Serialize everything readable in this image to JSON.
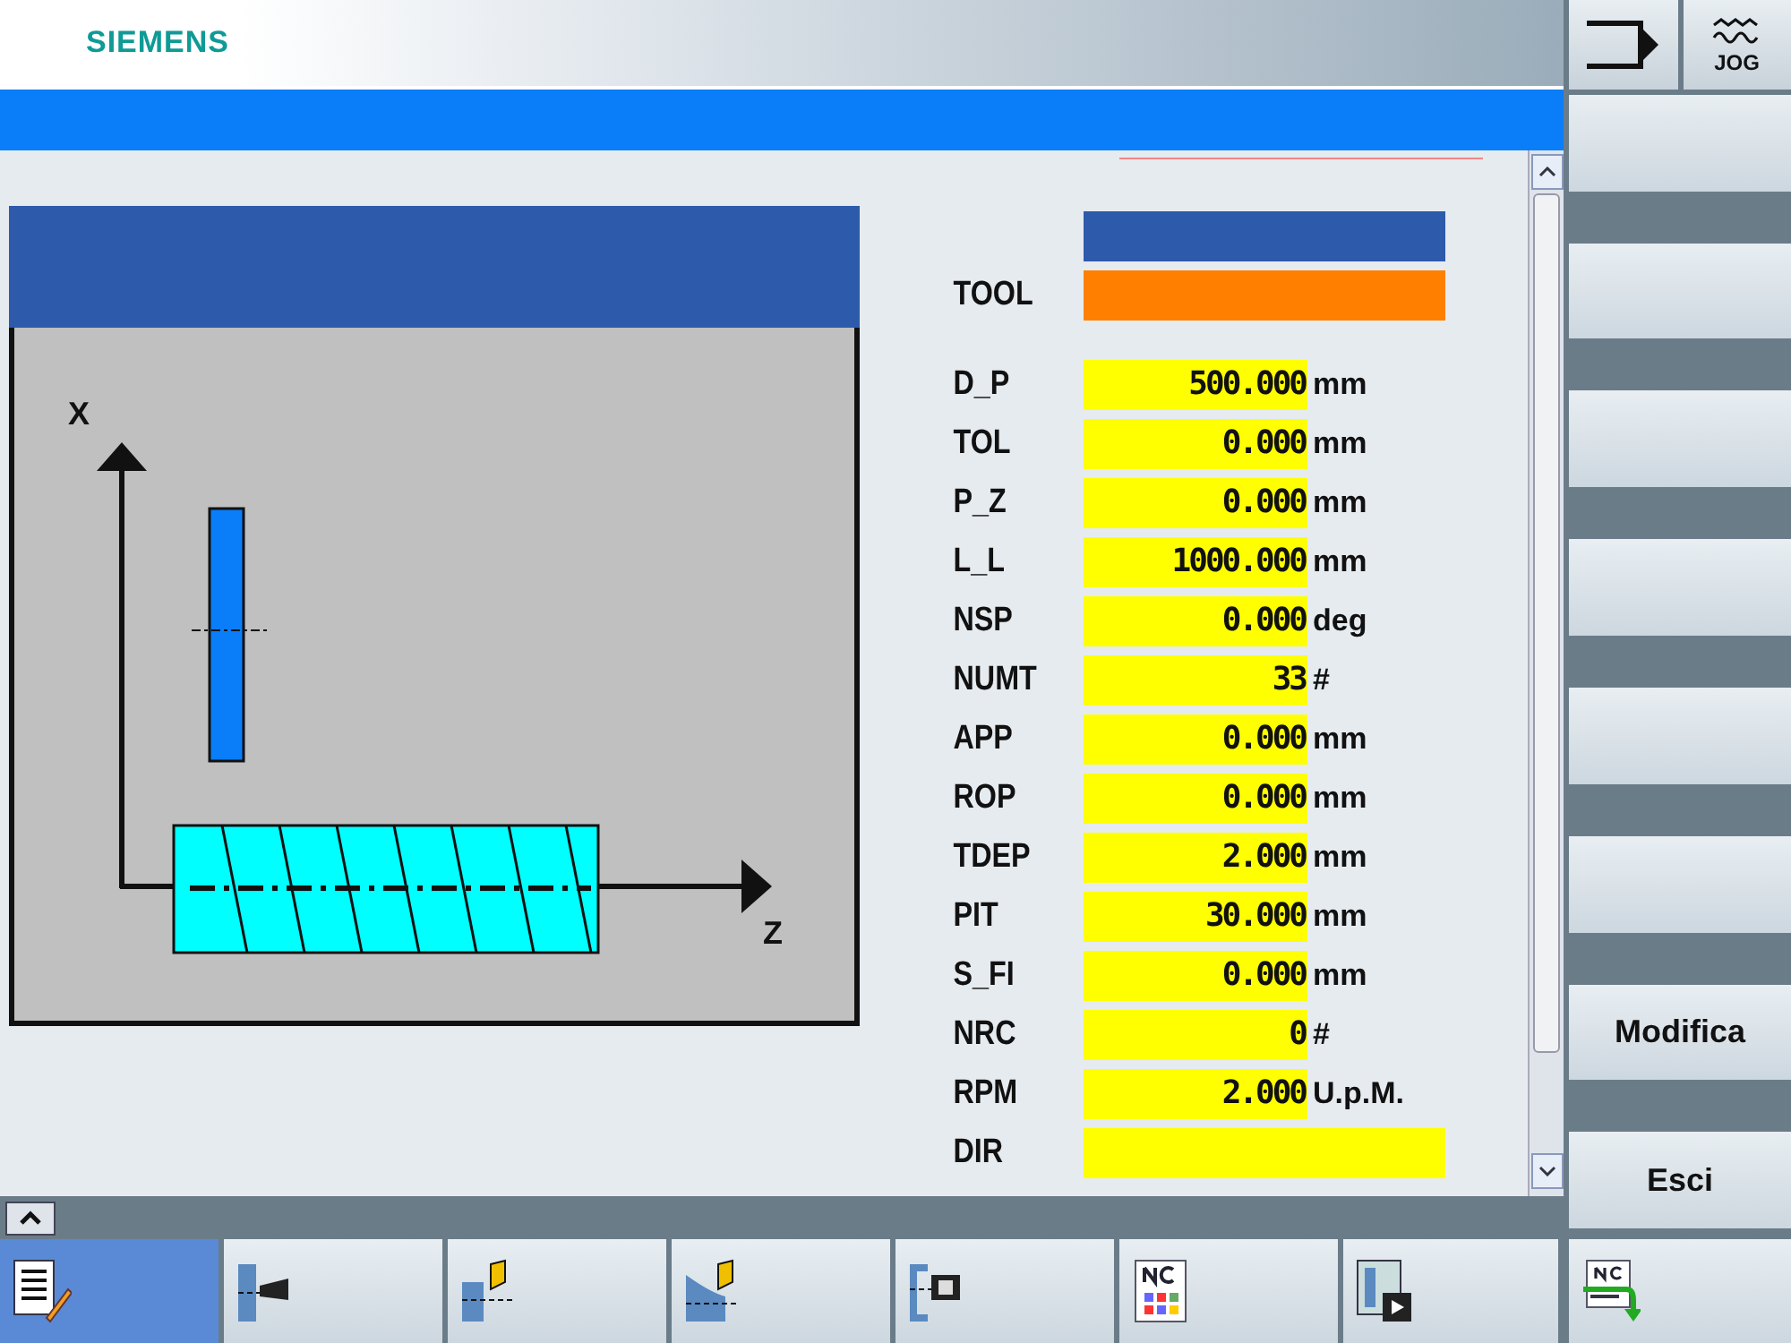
{
  "header": {
    "brand": "SIEMENS",
    "mode": "JOG"
  },
  "tool": {
    "label": "TOOL"
  },
  "parameters": [
    {
      "kind": "number",
      "label": "D_P",
      "value": "500.000",
      "unit": "mm"
    },
    {
      "kind": "number",
      "label": "TOL",
      "value": "0.000",
      "unit": "mm"
    },
    {
      "kind": "number",
      "label": "P_Z",
      "value": "0.000",
      "unit": "mm"
    },
    {
      "kind": "number",
      "label": "L_L",
      "value": "1000.000",
      "unit": "mm"
    },
    {
      "kind": "number",
      "label": "NSP",
      "value": "0.000",
      "unit": "deg"
    },
    {
      "kind": "number",
      "label": "NUMT",
      "value": "33",
      "unit": "#"
    },
    {
      "kind": "number",
      "label": "APP",
      "value": "0.000",
      "unit": "mm"
    },
    {
      "kind": "number",
      "label": "ROP",
      "value": "0.000",
      "unit": "mm"
    },
    {
      "kind": "number",
      "label": "TDEP",
      "value": "2.000",
      "unit": "mm"
    },
    {
      "kind": "number",
      "label": "PIT",
      "value": "30.000",
      "unit": "mm"
    },
    {
      "kind": "number",
      "label": "S_FI",
      "value": "0.000",
      "unit": "mm"
    },
    {
      "kind": "number",
      "label": "NRC",
      "value": "0",
      "unit": "#"
    },
    {
      "kind": "number",
      "label": "RPM",
      "value": "2.000",
      "unit": "U.p.M."
    },
    {
      "kind": "select",
      "label": "DIR"
    }
  ],
  "graphic": {
    "x_label": "X",
    "z_label": "Z"
  },
  "vertical_softkeys": [
    {
      "label": "Modifica"
    },
    {
      "label": "Esci"
    }
  ],
  "bottom_softkeys": [
    {
      "kind": "edit",
      "selected": true
    },
    {
      "kind": "drill",
      "selected": false
    },
    {
      "kind": "turn",
      "selected": false
    },
    {
      "kind": "contour",
      "selected": false
    },
    {
      "kind": "face",
      "selected": false
    },
    {
      "kind": "nc",
      "selected": false
    },
    {
      "kind": "simulate",
      "selected": false
    },
    {
      "kind": "ncload",
      "selected": false
    }
  ]
}
